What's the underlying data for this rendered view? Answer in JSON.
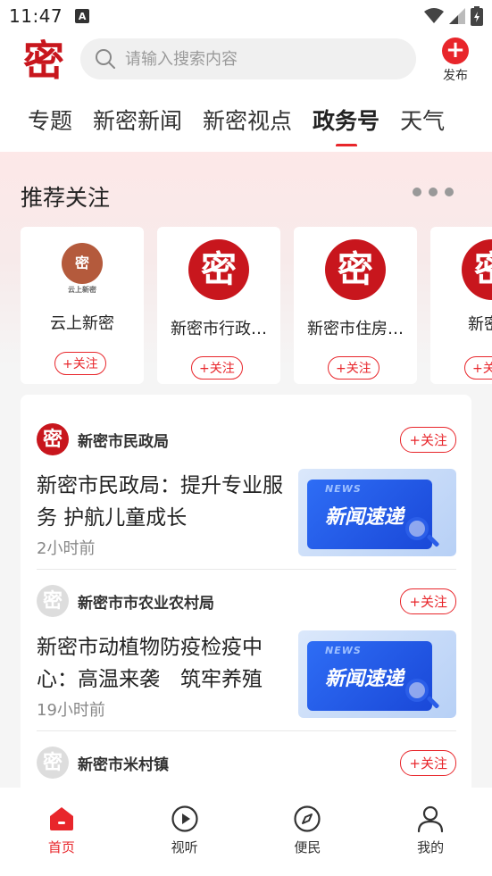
{
  "status_bar": {
    "time": "11:47",
    "notification_icon": "A"
  },
  "header": {
    "logo_char": "密",
    "search": {
      "placeholder": "请输入搜索内容"
    },
    "publish_label": "发布",
    "tabs": [
      {
        "label": "专题",
        "active": false
      },
      {
        "label": "新密新闻",
        "active": false
      },
      {
        "label": "新密视点",
        "active": false
      },
      {
        "label": "政务号",
        "active": true
      },
      {
        "label": "天气",
        "active": false
      }
    ]
  },
  "recommend": {
    "title": "推荐关注",
    "follow_label": "+关注",
    "cards": [
      {
        "name": "云上新密",
        "avatar": "seal",
        "seal_sub": "云上新密"
      },
      {
        "name": "新密市行政…",
        "avatar": "密"
      },
      {
        "name": "新密市住房…",
        "avatar": "密"
      },
      {
        "name": "新密市",
        "avatar": "密"
      }
    ]
  },
  "feed": {
    "follow_label": "+关注",
    "posts": [
      {
        "source": "新密市民政局",
        "avatar": "密",
        "title": "新密市民政局：提升专业服务 护航儿童成长",
        "time": "2小时前",
        "thumb_news": "NEWS",
        "thumb_title": "新闻速递"
      },
      {
        "source": "新密市市农业农村局",
        "avatar": "密",
        "title": "新密市动植物防疫检疫中心：高温来袭　筑牢养殖",
        "time": "19小时前",
        "thumb_news": "NEWS",
        "thumb_title": "新闻速递"
      },
      {
        "source": "新密市米村镇",
        "avatar": "密"
      }
    ]
  },
  "bottom_nav": {
    "items": [
      {
        "label": "首页",
        "icon": "home-icon",
        "active": true
      },
      {
        "label": "视听",
        "icon": "play-icon",
        "active": false
      },
      {
        "label": "便民",
        "icon": "compass-icon",
        "active": false
      },
      {
        "label": "我的",
        "icon": "user-icon",
        "active": false
      }
    ]
  },
  "colors": {
    "accent": "#e8262b",
    "logo": "#c8161d"
  }
}
